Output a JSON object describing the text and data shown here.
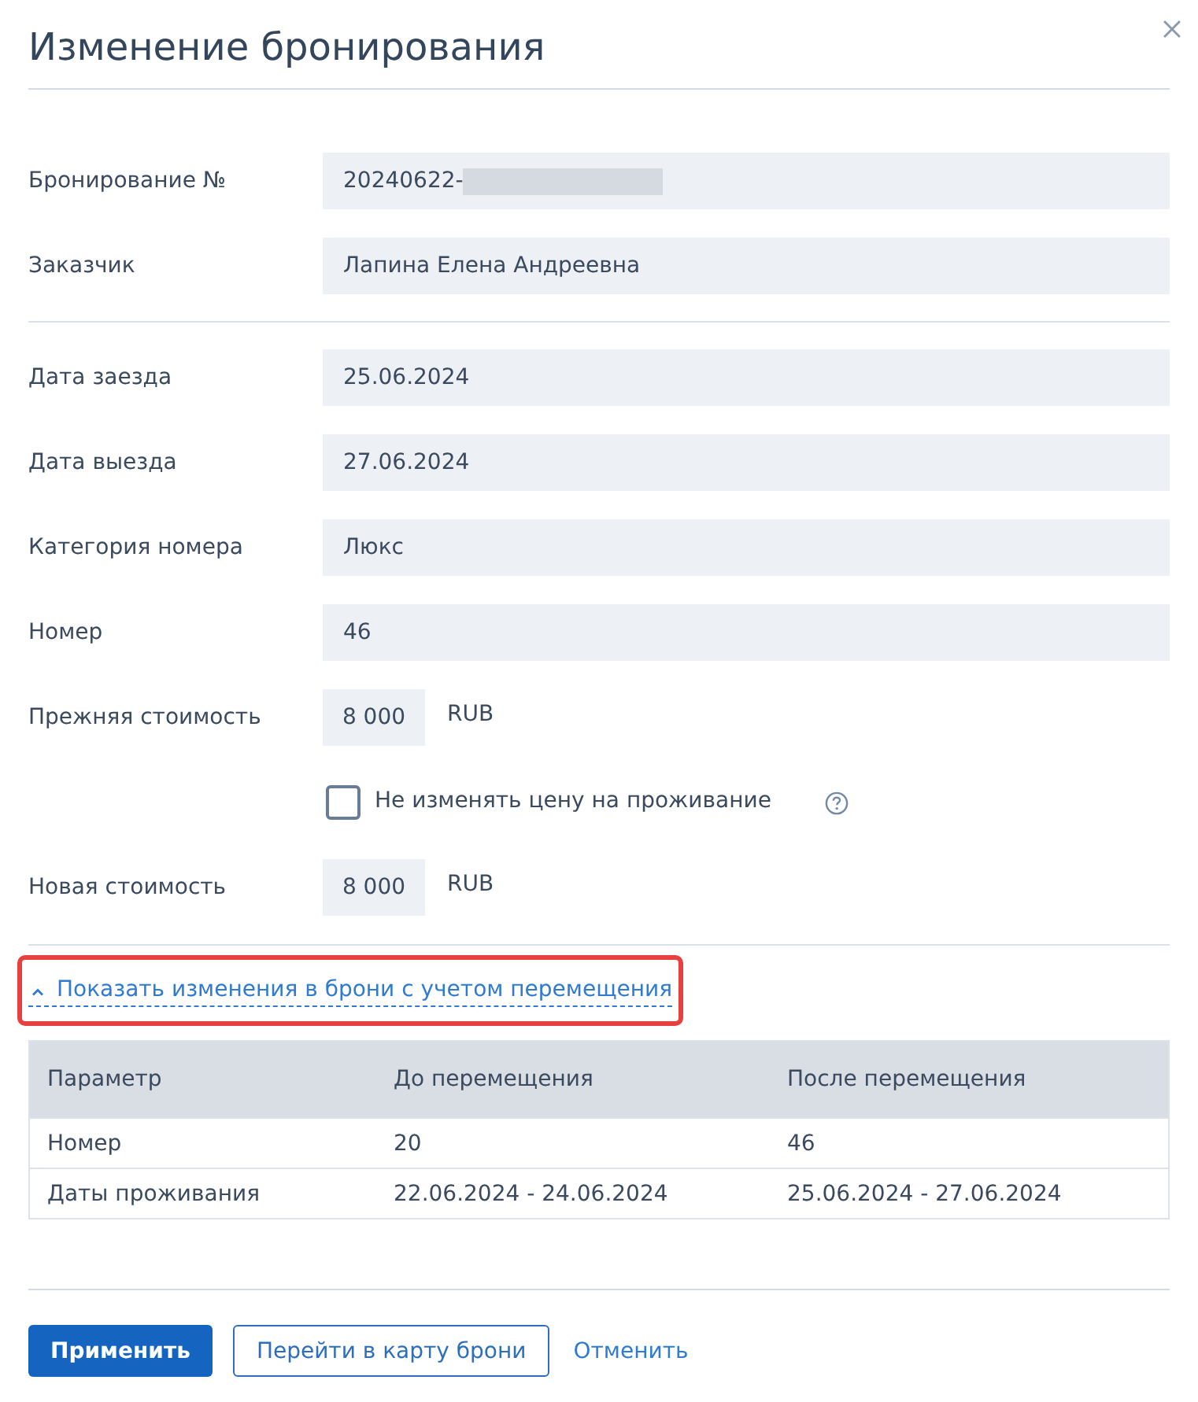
{
  "dialog": {
    "title": "Изменение бронирования"
  },
  "field_groups": [
    {
      "fields": [
        {
          "kind": "text",
          "label": "Бронирование №",
          "value": "20240622-",
          "redacted": true
        },
        {
          "kind": "text",
          "label": "Заказчик",
          "value": "Лапина Елена Андреевна"
        }
      ]
    },
    {
      "fields": [
        {
          "kind": "text",
          "label": "Дата заезда",
          "value": "25.06.2024"
        },
        {
          "kind": "text",
          "label": "Дата выезда",
          "value": "27.06.2024"
        },
        {
          "kind": "text",
          "label": "Категория номера",
          "value": "Люкс"
        },
        {
          "kind": "text",
          "label": "Номер",
          "value": "46"
        },
        {
          "kind": "price",
          "label": "Прежняя стоимость",
          "value": "8 000",
          "currency": "RUB"
        },
        {
          "kind": "checkbox",
          "label": "Не изменять цену на проживание",
          "checked": false,
          "help": true
        },
        {
          "kind": "price",
          "label": "Новая стоимость",
          "value": "8 000",
          "currency": "RUB"
        }
      ]
    }
  ],
  "changes_toggle": {
    "label": "Показать изменения в брони с учетом перемещения",
    "expanded": true,
    "highlighted": true
  },
  "changes_table": {
    "columns": [
      "Параметр",
      "До перемещения",
      "После перемещения"
    ],
    "rows": [
      [
        "Номер",
        "20",
        "46"
      ],
      [
        "Даты проживания",
        "22.06.2024 - 24.06.2024",
        "25.06.2024 - 27.06.2024"
      ]
    ]
  },
  "buttons": [
    {
      "kind": "primary",
      "label": "Применить"
    },
    {
      "kind": "outline",
      "label": "Перейти в карту брони"
    },
    {
      "kind": "link",
      "label": "Отменить"
    }
  ]
}
